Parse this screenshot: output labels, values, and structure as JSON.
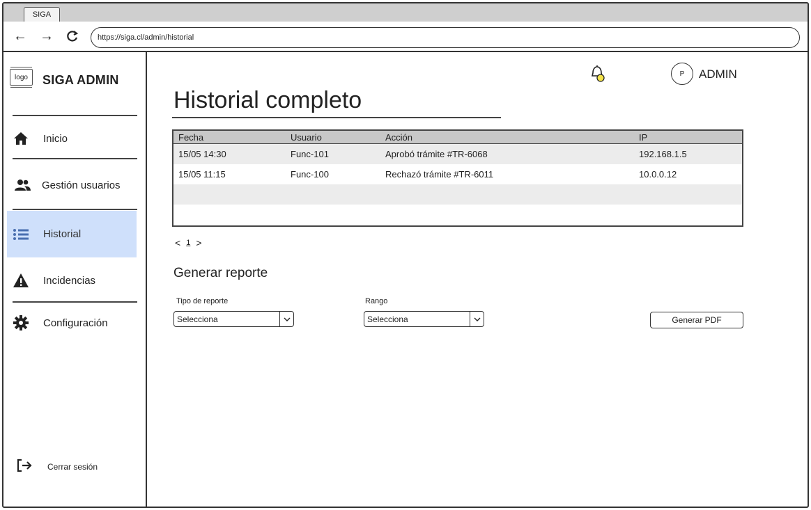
{
  "browser": {
    "tab_title": "SIGA",
    "url": "https://siga.cl/admin/historial"
  },
  "sidebar": {
    "logo_text": "logo",
    "brand": "SIGA ADMIN",
    "items": [
      {
        "label": "Inicio",
        "icon": "home-icon"
      },
      {
        "label": "Gestión usuarios",
        "icon": "users-icon"
      },
      {
        "label": "Historial",
        "icon": "list-icon",
        "active": true
      },
      {
        "label": "Incidencias",
        "icon": "warning-icon"
      },
      {
        "label": "Configuración",
        "icon": "gear-icon"
      }
    ],
    "logout": "Cerrar sesión"
  },
  "header": {
    "avatar_initial": "P",
    "user_label": "ADMIN",
    "notification_color": "#f5e44a"
  },
  "main": {
    "title": "Historial completo",
    "table": {
      "columns": [
        "Fecha",
        "Usuario",
        "Acción",
        "IP"
      ],
      "rows": [
        [
          "15/05 14:30",
          "Func-101",
          "Aprobó trámite #TR-6068",
          "192.168.1.5"
        ],
        [
          "15/05 11:15",
          "Func-100",
          "Rechazó trámite #TR-6011",
          "10.0.0.12"
        ]
      ]
    },
    "pagination": {
      "prev": "<",
      "page": "1",
      "next": ">"
    },
    "report": {
      "title": "Generar reporte",
      "type_label": "Tipo de reporte",
      "type_value": "Selecciona",
      "range_label": "Rango",
      "range_value": "Selecciona",
      "button": "Generar PDF"
    }
  },
  "colors": {
    "active_bg": "#cfe0fb",
    "table_header": "#c8c8c8",
    "row_shade": "#ececec"
  }
}
